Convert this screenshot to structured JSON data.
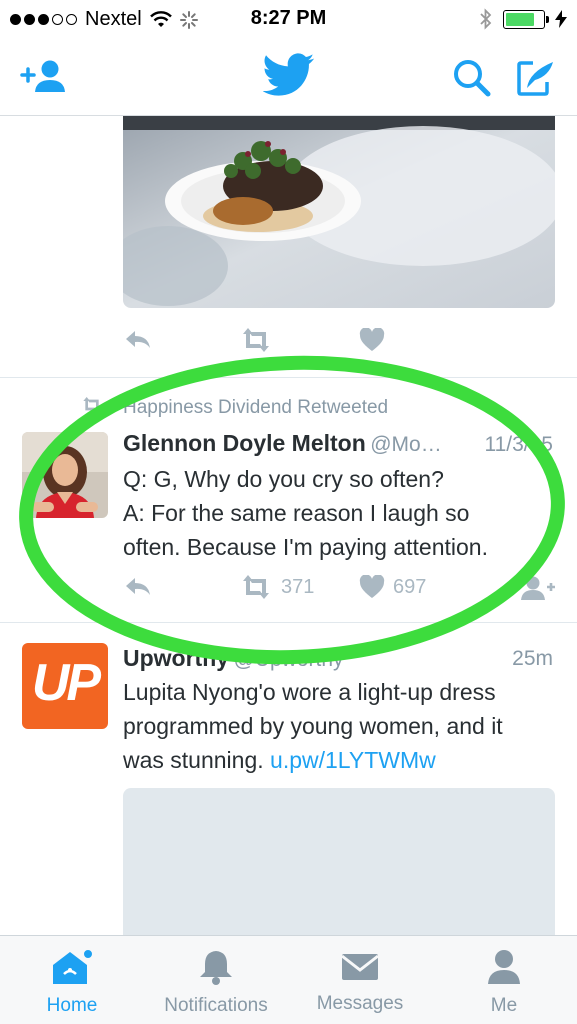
{
  "status_bar": {
    "carrier": "Nextel",
    "time": "8:27 PM"
  },
  "nav": {
    "add_user_icon": "add-user-icon",
    "logo_icon": "twitter-bird-icon",
    "search_icon": "search-icon",
    "compose_icon": "compose-icon"
  },
  "tweets": [
    {
      "type": "media-only",
      "actions": {
        "reply": "",
        "retweet": "",
        "like": ""
      }
    },
    {
      "retweeted_by": "Happiness Dividend Retweeted",
      "name": "Glennon Doyle Melton",
      "handle": "@Mo…",
      "time": "11/3/15",
      "text_lines": [
        "Q: G, Why do you cry so often?",
        "A: For the same reason I laugh so",
        "often. Because I'm paying attention."
      ],
      "retweet_count": "371",
      "like_count": "697"
    },
    {
      "name": "Upworthy",
      "handle": "@Upworthy",
      "time": "25m",
      "avatar_text": "UP",
      "text_lines": [
        "Lupita Nyong'o wore a light-up dress",
        "programmed by young women, and it",
        "was stunning. "
      ],
      "link": "u.pw/1LYTWMw"
    }
  ],
  "tabbar": {
    "tabs": [
      {
        "label": "Home",
        "icon": "home-icon",
        "active": true
      },
      {
        "label": "Notifications",
        "icon": "bell-icon",
        "active": false
      },
      {
        "label": "Messages",
        "icon": "envelope-icon",
        "active": false
      },
      {
        "label": "Me",
        "icon": "person-icon",
        "active": false
      }
    ]
  },
  "colors": {
    "accent": "#1da1f2",
    "muted": "#8899a6",
    "annotation": "#3ddc3d",
    "upworthy": "#f26522",
    "battery": "#4cd964"
  }
}
